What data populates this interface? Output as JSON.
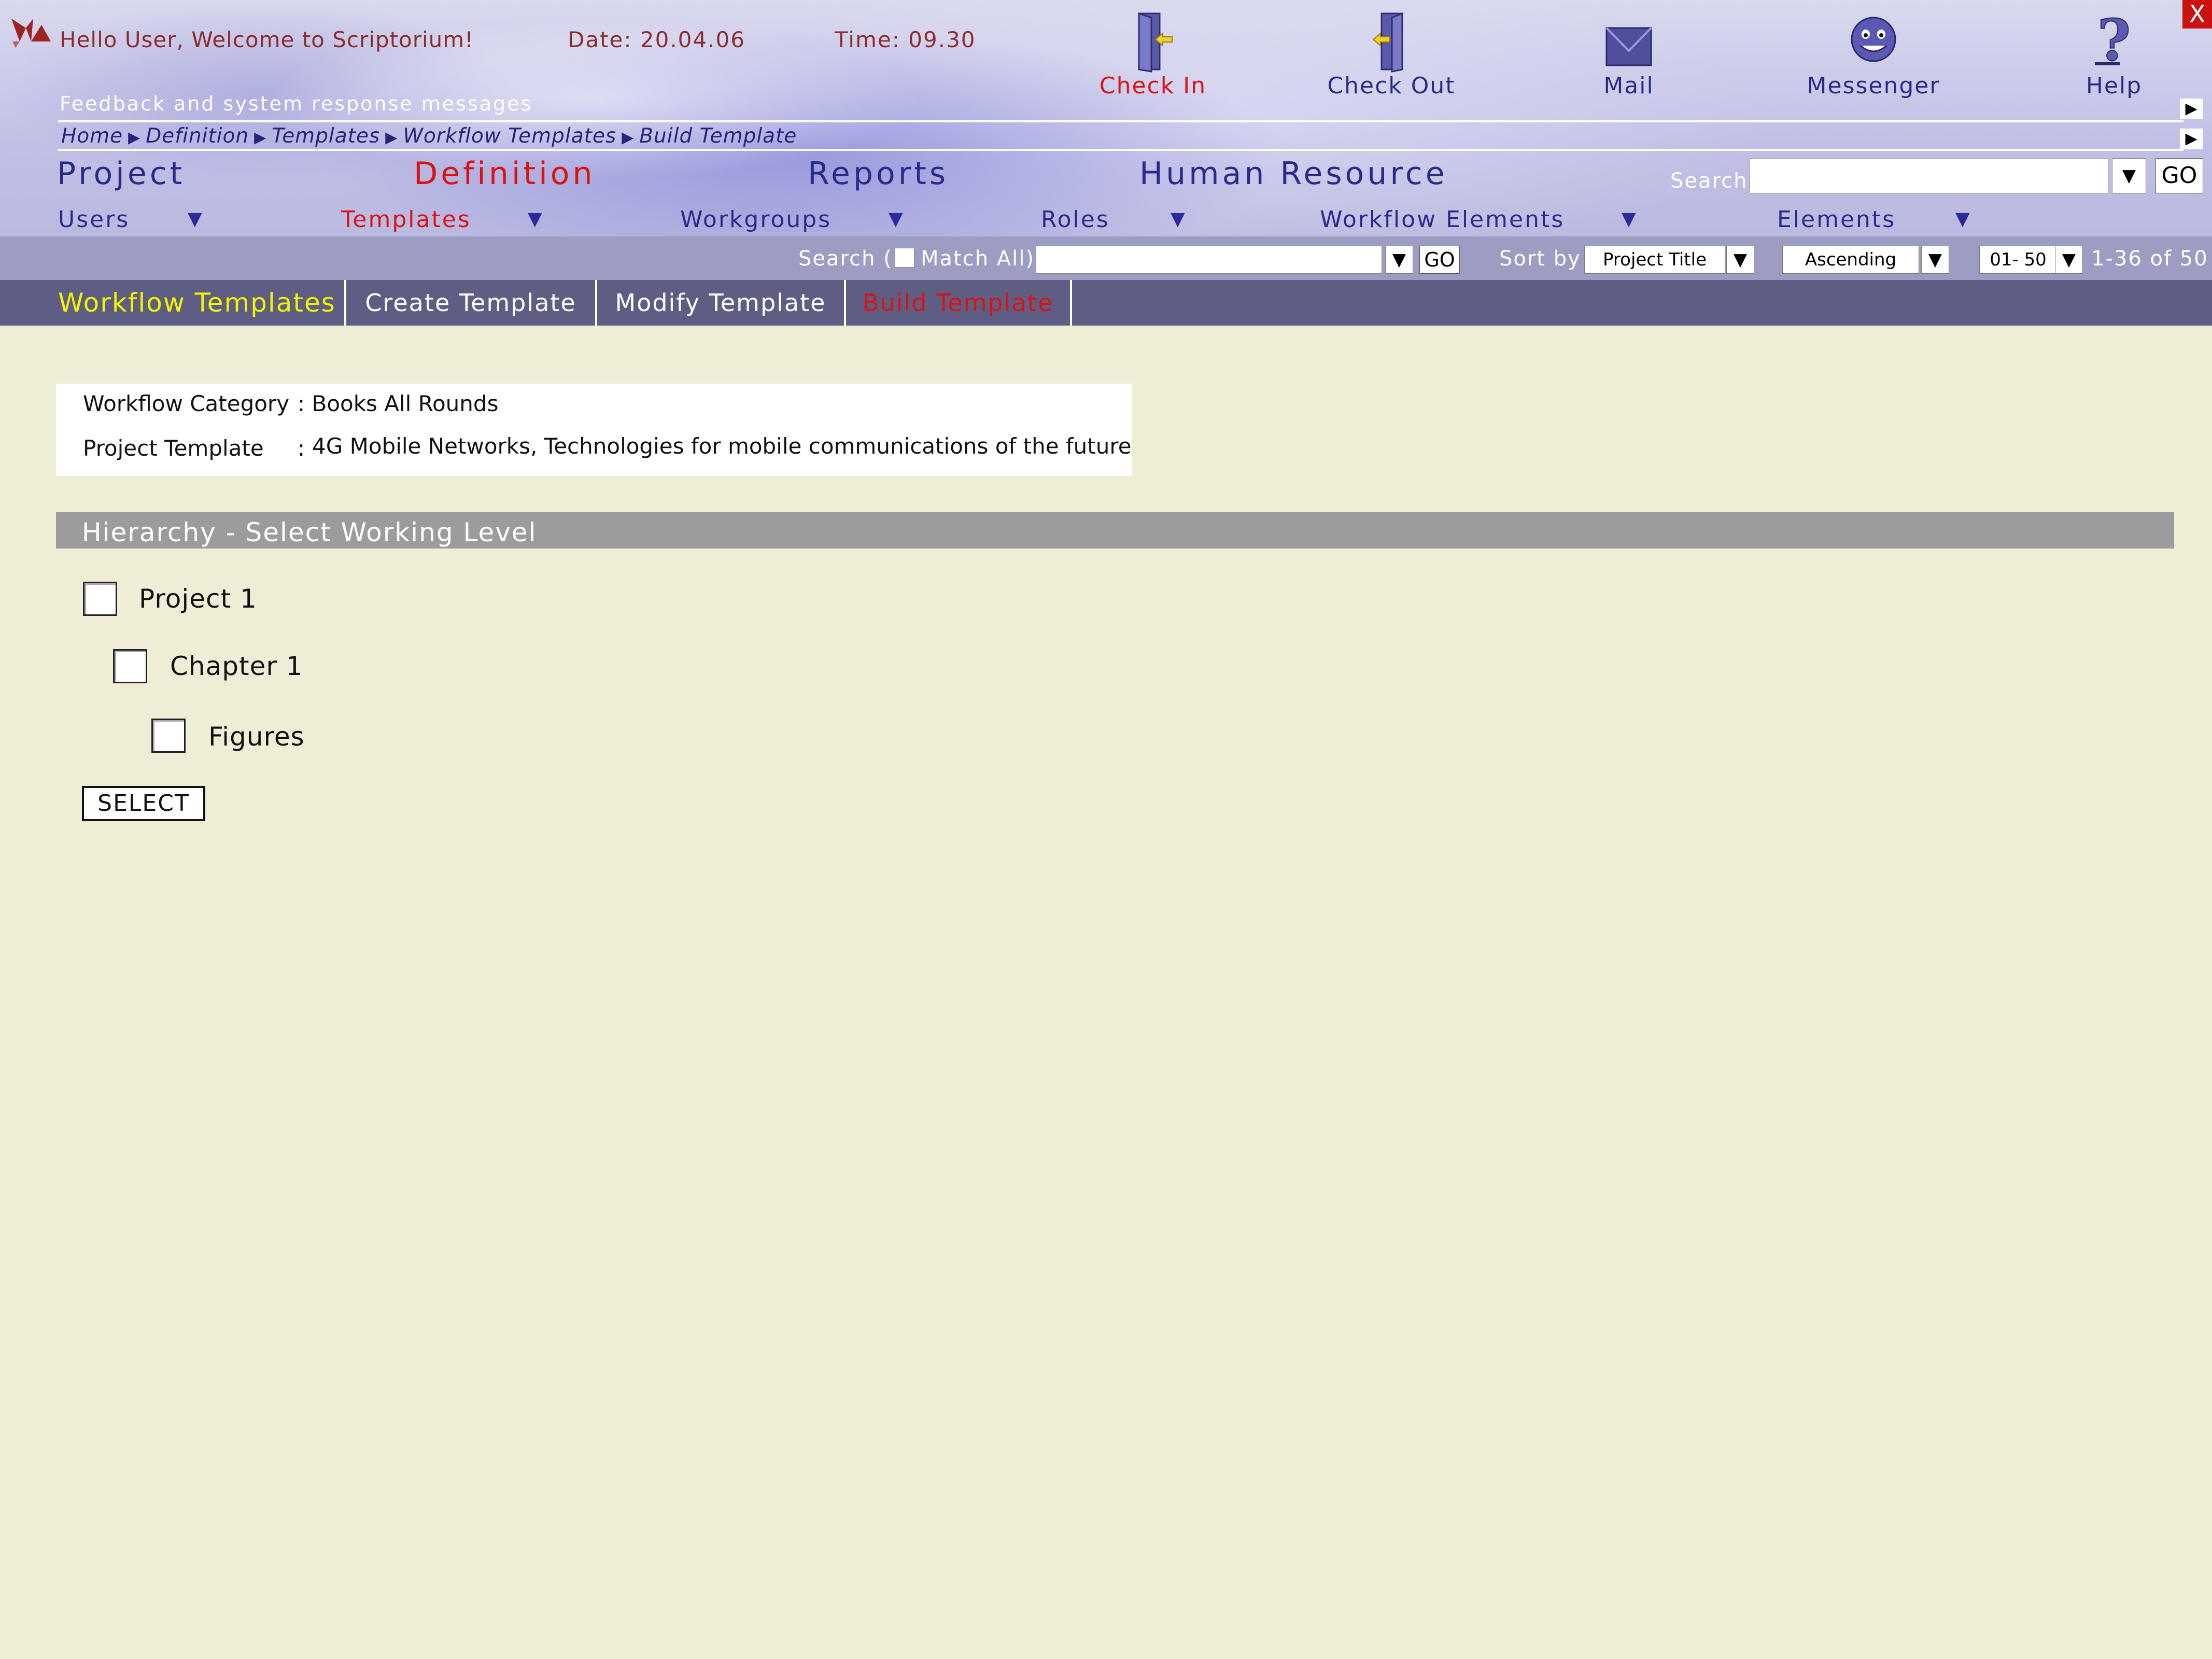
{
  "header": {
    "welcome": "Hello User, Welcome to Scriptorium!",
    "date": "Date: 20.04.06",
    "time": "Time: 09.30",
    "feedback": "Feedback and system response messages",
    "close_label": "X"
  },
  "tools": [
    {
      "label": "Check In",
      "icon": "check-in-door-icon",
      "active": true
    },
    {
      "label": "Check Out",
      "icon": "check-out-door-icon",
      "active": false
    },
    {
      "label": "Mail",
      "icon": "mail-envelope-icon",
      "active": false
    },
    {
      "label": "Messenger",
      "icon": "smiley-face-icon",
      "active": false
    },
    {
      "label": "Help",
      "icon": "question-mark-icon",
      "active": false
    }
  ],
  "breadcrumb": [
    "Home",
    "Definition",
    "Templates",
    "Workflow Templates",
    "Build Template"
  ],
  "main_nav": [
    {
      "label": "Project",
      "active": false
    },
    {
      "label": "Definition",
      "active": true
    },
    {
      "label": "Reports",
      "active": false
    },
    {
      "label": "Human Resource",
      "active": false
    }
  ],
  "search": {
    "label": "Search",
    "go": "GO",
    "value": ""
  },
  "sub_nav": [
    {
      "label": "Users",
      "active": false
    },
    {
      "label": "Templates",
      "active": true
    },
    {
      "label": "Workgroups",
      "active": false
    },
    {
      "label": "Roles",
      "active": false
    },
    {
      "label": "Workflow Elements",
      "active": false
    },
    {
      "label": "Elements",
      "active": false
    }
  ],
  "filter": {
    "search_label": "Search (",
    "match_all": "Match All)",
    "go": "GO",
    "sort_label": "Sort by",
    "sort_value": "Project Title",
    "order_value": "Ascending",
    "range_value": "01- 50",
    "count": "1-36 of 50"
  },
  "tabs": [
    {
      "label": "Workflow Templates",
      "state": "title"
    },
    {
      "label": "Create Template",
      "state": "normal"
    },
    {
      "label": "Modify Template",
      "state": "normal"
    },
    {
      "label": "Build Template",
      "state": "active"
    }
  ],
  "info": {
    "category_label": "Workflow Category",
    "category_value": ": Books All Rounds",
    "template_label": "Project Template",
    "template_sep": ":",
    "template_value": "4G Mobile Networks, Technologies for mobile  communications of the future"
  },
  "hierarchy": {
    "title": "Hierarchy - Select Working Level",
    "levels": [
      {
        "label": "Project 1",
        "checked": false
      },
      {
        "label": "Chapter 1",
        "checked": false
      },
      {
        "label": "Figures",
        "checked": false
      }
    ],
    "select_button": "SELECT"
  },
  "colors": {
    "accent_red": "#dd1111",
    "nav_blue": "#2a2a8a",
    "tab_bar": "#5e5e85",
    "page_bg": "#efedd6",
    "tab_title_yellow": "#f4f400"
  }
}
